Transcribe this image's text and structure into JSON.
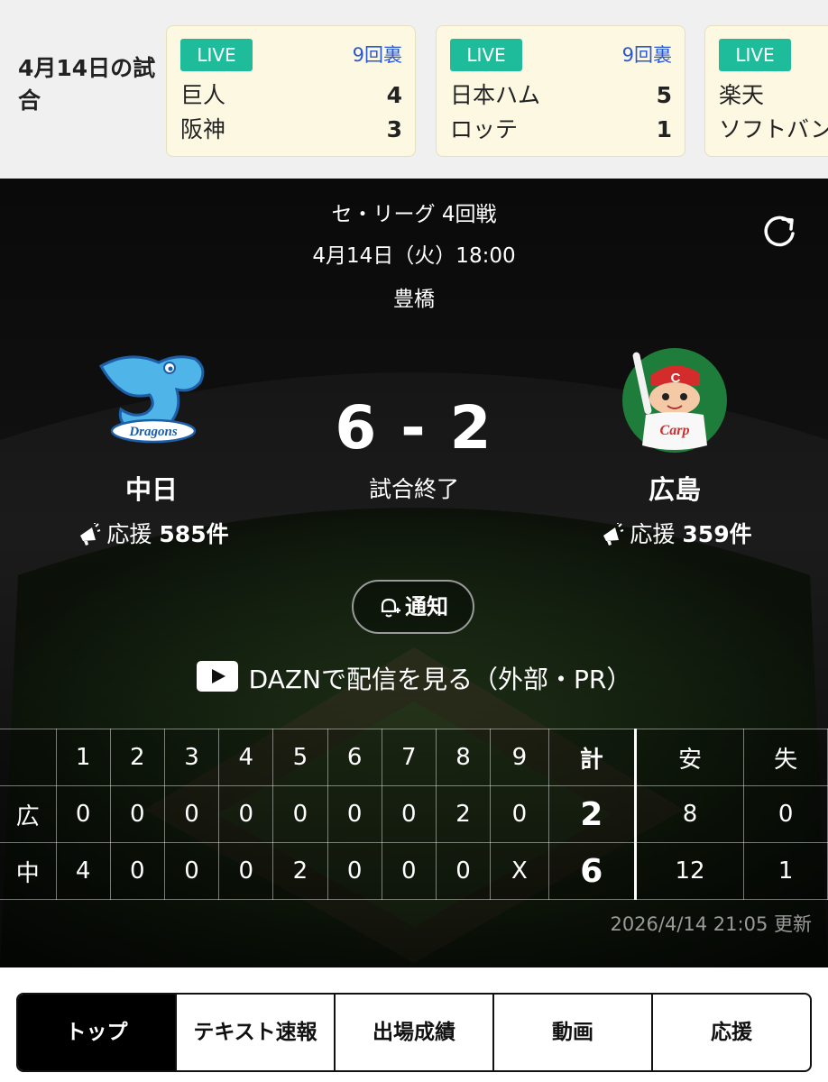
{
  "strip": {
    "date": "4月14日の試合",
    "games": [
      {
        "live": "LIVE",
        "inning": "9回裏",
        "team1": "巨人",
        "score1": "4",
        "team2": "阪神",
        "score2": "3"
      },
      {
        "live": "LIVE",
        "inning": "9回裏",
        "team1": "日本ハム",
        "score1": "5",
        "team2": "ロッテ",
        "score2": "1"
      },
      {
        "live": "LIVE",
        "inning": "",
        "team1": "楽天",
        "score1": "",
        "team2": "ソフトバンク",
        "score2": ""
      }
    ]
  },
  "game": {
    "league": "セ・リーグ 4回戦",
    "datetime": "4月14日（火）18:00",
    "venue": "豊橋",
    "score": "6 - 2",
    "status": "試合終了",
    "home": {
      "name": "中日",
      "cheer_label": "応援",
      "cheer_count": "585件",
      "logo": "dragons-logo"
    },
    "away": {
      "name": "広島",
      "cheer_label": "応援",
      "cheer_count": "359件",
      "logo": "carp-logo"
    },
    "notify_label": "通知",
    "dazn_label": "DAZNで配信を見る（外部・PR）"
  },
  "linescore": {
    "headers": [
      "",
      "1",
      "2",
      "3",
      "4",
      "5",
      "6",
      "7",
      "8",
      "9",
      "計",
      "安",
      "失"
    ],
    "rows": [
      {
        "team": "広",
        "innings": [
          "0",
          "0",
          "0",
          "0",
          "0",
          "0",
          "0",
          "2",
          "0"
        ],
        "total": "2",
        "hits": "8",
        "errors": "0"
      },
      {
        "team": "中",
        "innings": [
          "4",
          "0",
          "0",
          "0",
          "2",
          "0",
          "0",
          "0",
          "X"
        ],
        "total": "6",
        "hits": "12",
        "errors": "1"
      }
    ],
    "updated": "2026/4/14 21:05 更新"
  },
  "tabs": [
    "トップ",
    "テキスト速報",
    "出場成績",
    "動画",
    "応援"
  ],
  "colors": {
    "live": "#1fbc9c",
    "inning": "#2a57d4",
    "card": "#fcf8e2"
  }
}
